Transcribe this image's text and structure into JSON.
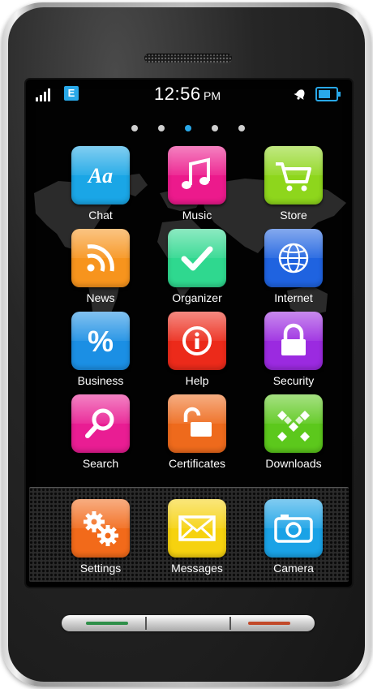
{
  "status_bar": {
    "network_type": "E",
    "time": "12:56",
    "ampm": "PM",
    "battery_level": 0.8
  },
  "page_indicator": {
    "count": 5,
    "active_index": 2
  },
  "apps": [
    {
      "label": "Chat",
      "color": "#1aa6e6",
      "icon": "chat-icon"
    },
    {
      "label": "Music",
      "color": "#ec1a8c",
      "icon": "music-note-icon"
    },
    {
      "label": "Store",
      "color": "#8ed61c",
      "icon": "shopping-cart-icon"
    },
    {
      "label": "News",
      "color": "#f7941d",
      "icon": "rss-icon"
    },
    {
      "label": "Organizer",
      "color": "#2fd88f",
      "icon": "checkmark-icon"
    },
    {
      "label": "Internet",
      "color": "#1f63e0",
      "icon": "globe-icon"
    },
    {
      "label": "Business",
      "color": "#1b8fe4",
      "icon": "percent-icon"
    },
    {
      "label": "Help",
      "color": "#ec2a1a",
      "icon": "info-icon"
    },
    {
      "label": "Security",
      "color": "#9b2ae0",
      "icon": "lock-icon"
    },
    {
      "label": "Search",
      "color": "#e91d93",
      "icon": "magnifier-icon"
    },
    {
      "label": "Certificates",
      "color": "#ee6a1c",
      "icon": "open-lock-icon"
    },
    {
      "label": "Downloads",
      "color": "#5cc81c",
      "icon": "download-icon"
    }
  ],
  "dock": [
    {
      "label": "Settings",
      "color": "#f26a1a",
      "icon": "gears-icon"
    },
    {
      "label": "Messages",
      "color": "#f6d20f",
      "icon": "envelope-icon"
    },
    {
      "label": "Camera",
      "color": "#1aa2e6",
      "icon": "camera-icon"
    }
  ]
}
